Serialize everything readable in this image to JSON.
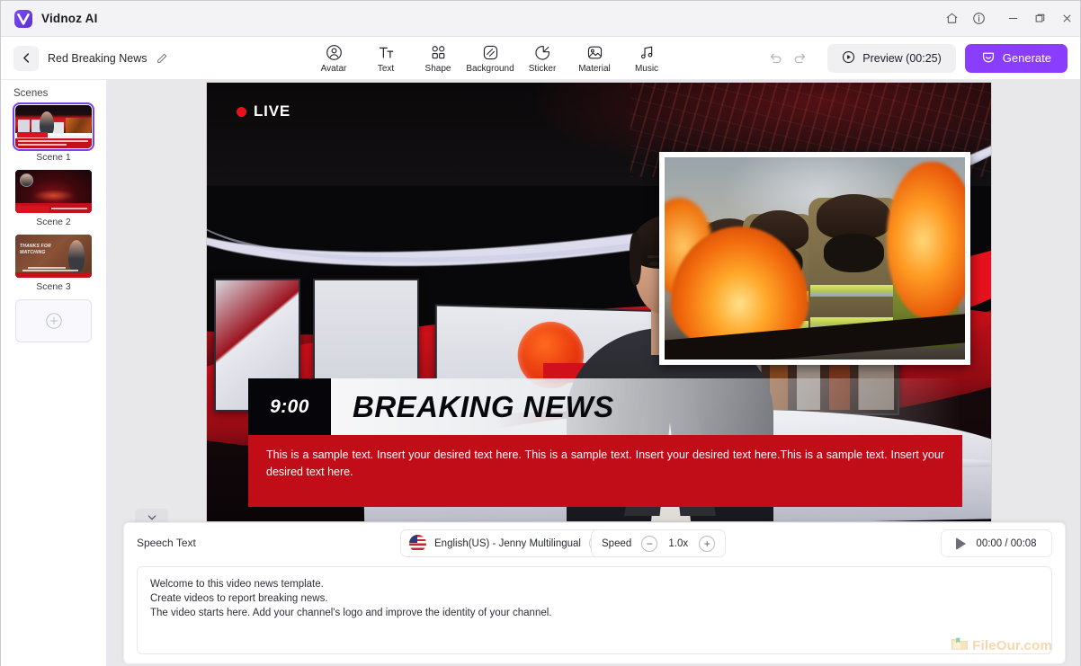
{
  "window": {
    "brand": "Vidnoz AI",
    "controls": [
      {
        "name": "home-icon",
        "label": "Home"
      },
      {
        "name": "info-icon",
        "label": "Info"
      },
      {
        "name": "minimize-icon",
        "label": "Minimize"
      },
      {
        "name": "maximize-icon",
        "label": "Restore"
      },
      {
        "name": "close-icon",
        "label": "Close"
      }
    ]
  },
  "toolbar": {
    "back_label": "Back",
    "project_title": "Red Breaking News",
    "edit_icon": "pencil-icon",
    "tools": [
      {
        "label": "Avatar",
        "icon": "avatar-icon"
      },
      {
        "label": "Text",
        "icon": "text-icon"
      },
      {
        "label": "Shape",
        "icon": "shape-icon"
      },
      {
        "label": "Background",
        "icon": "background-icon"
      },
      {
        "label": "Sticker",
        "icon": "sticker-icon"
      },
      {
        "label": "Material",
        "icon": "material-icon"
      },
      {
        "label": "Music",
        "icon": "music-icon"
      }
    ],
    "undo_label": "Undo",
    "redo_label": "Redo",
    "preview_label": "Preview (00:25)",
    "generate_label": "Generate",
    "generate_color": "#8b3dff"
  },
  "scenes": {
    "header": "Scenes",
    "items": [
      {
        "label": "Scene 1",
        "selected": true
      },
      {
        "label": "Scene 2",
        "selected": false
      },
      {
        "label": "Scene 3",
        "selected": false
      }
    ],
    "add_label": "+",
    "selected_outline_color": "#7b3ff0",
    "thumb3_text_line1": "THANKS FOR",
    "thumb3_text_line2": "WATCHING"
  },
  "canvas": {
    "collapse_icon": "chevron-down-icon",
    "live_badge": "LIVE",
    "live_color": "#e8121d",
    "timestamp": "9:00",
    "headline": "BREAKING NEWS",
    "ticker_text": "This is a sample text. Insert your desired text here. This is a sample text. Insert your desired text here.This is a sample text. Insert your desired text here.",
    "ticker_color": "#c00d17"
  },
  "speech_panel": {
    "label": "Speech Text",
    "voice": {
      "flag": "us-flag-icon",
      "name": "English(US) - Jenny Multilingual",
      "more_icon": "ellipsis-icon"
    },
    "speed": {
      "label": "Speed",
      "minus": "−",
      "value": "1.0x",
      "plus": "+"
    },
    "player": {
      "play_icon": "play-icon",
      "time": "00:00 / 00:08"
    },
    "script_lines": [
      "Welcome to this video news template.",
      "Create videos to report breaking news.",
      "The video starts here. Add your channel's logo and improve the identity of your channel."
    ]
  },
  "watermark": {
    "text": "FileOur.com",
    "icon": "file-folder-icon"
  }
}
